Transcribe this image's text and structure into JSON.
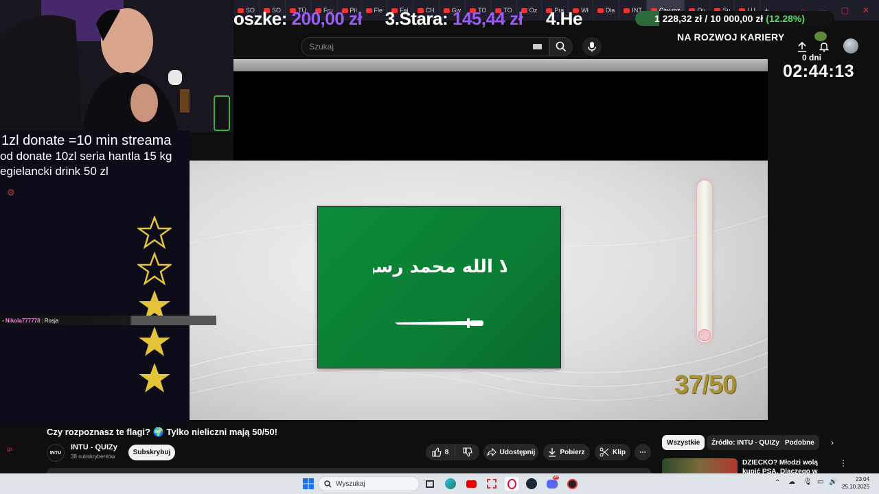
{
  "browser": {
    "tabs": [
      "SO",
      "SO",
      "TÜ",
      "Fru",
      "Pił",
      "Fle",
      "Fai",
      "CH",
      "Giv",
      "TO",
      "TO",
      "Oz",
      "Pra",
      "Wł",
      "Dla",
      "INT",
      "Czy roz",
      "Qu",
      "Su",
      "LU"
    ],
    "active_tab_index": 16,
    "new_tab_label": "+"
  },
  "stream_overlay": {
    "ticker_items": [
      {
        "name": "oszke:",
        "value": "200,00 zł"
      },
      {
        "name": "3.Stara:",
        "value": "145,44 zł"
      },
      {
        "name": "4.He",
        "value": ""
      }
    ],
    "goal_current": "1 228,32 zł",
    "goal_separator": "/",
    "goal_target": "10 000,00 zł",
    "goal_percent": "(12.28%)",
    "goal_fraction": 0.1228,
    "banner": "NA ROZWOJ KARIERY",
    "days_label": "0 dni",
    "timer": "02:44:13",
    "rules": [
      "1zl donate =10 min streama",
      "od donate 10zl seria hantla 15 kg",
      "egielancki drink 50 zl"
    ],
    "chat": {
      "user": "Nikola777778",
      "separator": ":",
      "message": "Rosja"
    },
    "stars_total": 5,
    "stars_filled": 3
  },
  "youtube": {
    "search_placeholder": "Szukaj",
    "quiz_score": "37/50",
    "flag_text": "لا إله إلا الله محمد رسول الله",
    "video_title": "Czy rozpoznasz te flagi? 🌍 Tylko nieliczni mają 50/50!",
    "channel_name": "INTU - QUIZy",
    "channel_avatar_text": "INTU",
    "subscribers": "38 subskrybentów",
    "subscribe_label": "Subskrybuj",
    "likes": "8",
    "share_label": "Udostępnij",
    "download_label": "Pobierz",
    "clip_label": "Klip",
    "chips": [
      "Wszystkie",
      "Źródło: INTU - QUIZy",
      "Podobne"
    ],
    "recommended_title": "DZIECKO? Młodzi wolą kupić PSA. Dlaczego w Polsce rodzi"
  },
  "taskbar": {
    "search_placeholder": "Wyszukaj",
    "time": "23:04",
    "date": "25.10.2025",
    "discord_badge": "9+"
  },
  "colors": {
    "donation_value": "#9b5cf6",
    "goal_percent": "#5ad86b",
    "flag_green": "#0a7d34",
    "score_gold": "#a89237"
  }
}
